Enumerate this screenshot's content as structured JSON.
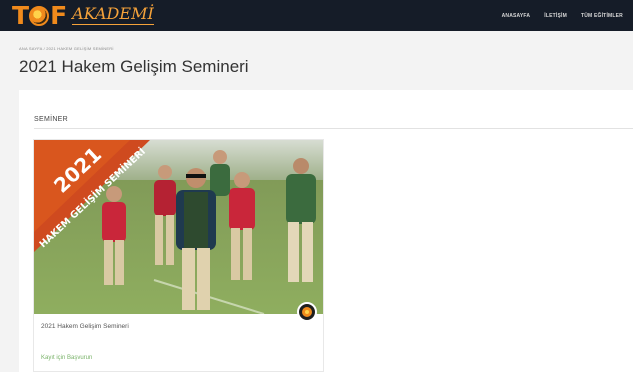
{
  "brand": {
    "logo_letters": "TOF",
    "logo_sub": "AKADEMİ",
    "colors": {
      "topbar": "#151c28",
      "accent": "#f08a1c"
    }
  },
  "nav": {
    "items": [
      "ANASAYFA",
      "İLETİŞİM",
      "TÜM EĞİTİMLER"
    ]
  },
  "breadcrumb": {
    "text": "ANA SAYFA  /  2021 HAKEM GELİŞİM SEMİNERİ"
  },
  "page": {
    "title": "2021 Hakem Gelişim Semineri"
  },
  "section": {
    "label": "SEMİNER"
  },
  "card": {
    "ribbon_year": "2021",
    "ribbon_text": "HAKEM GELİŞİM SEMİNERİ",
    "title": "2021 Hakem Gelişim Semineri",
    "cta": "Kayıt için Başvurun",
    "badge_icon": "whistle-ball-icon",
    "image_description": "group-of-referees-walking-on-grass"
  }
}
